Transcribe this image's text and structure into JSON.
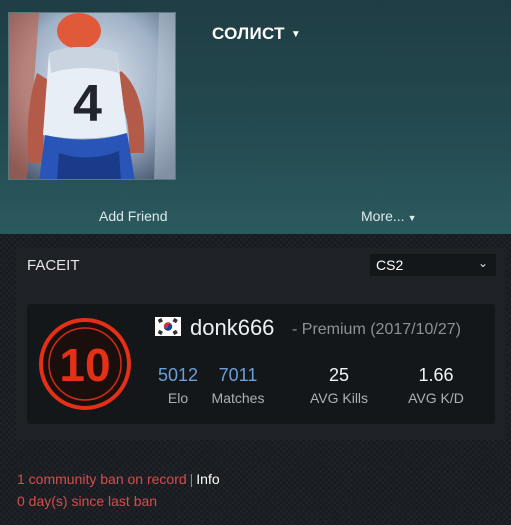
{
  "profile": {
    "persona_name": "СОЛИСТ",
    "avatar_icon": "basketball-player-avatar",
    "add_friend_label": "Add Friend",
    "more_label": "More..."
  },
  "faceit": {
    "title": "FACEIT",
    "game_selected": "CS2",
    "level": "10",
    "level_color": "#e53018",
    "country_flag": "south-korea-flag",
    "nickname": "donk666",
    "membership": "- Premium (2017/10/27)",
    "stats": [
      {
        "value": "5012",
        "label": "Elo",
        "color": "#6b9fd6"
      },
      {
        "value": "7011",
        "label": "Matches",
        "color": "#6b9fd6"
      },
      {
        "value": "25",
        "label": "AVG Kills",
        "color": "#f2f4f5"
      },
      {
        "value": "1.66",
        "label": "AVG K/D",
        "color": "#f2f4f5"
      }
    ]
  },
  "bans": {
    "community_ban": "1 community ban on record",
    "separator": "|",
    "info_label": "Info",
    "days_since": "0 day(s) since last ban",
    "ban_color": "#d44f4f"
  }
}
